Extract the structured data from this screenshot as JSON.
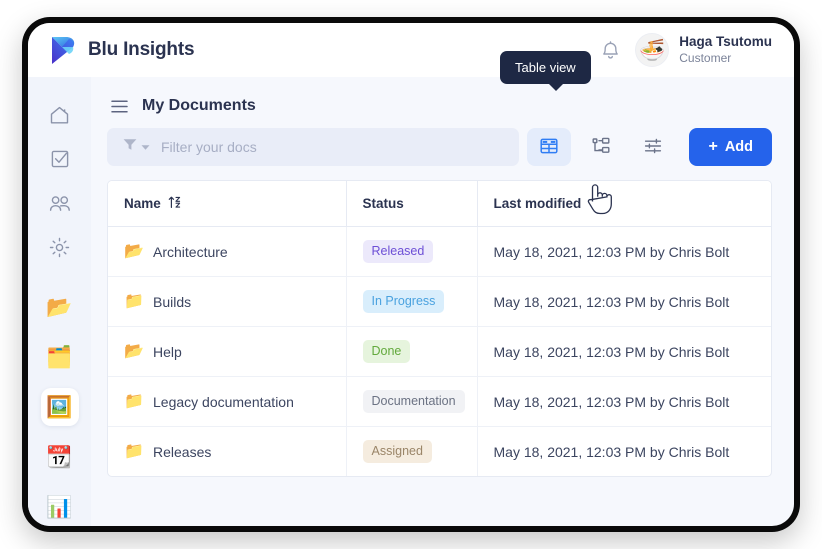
{
  "brand": {
    "name": "Blu Insights",
    "logo_icon": "blu-logo-icon"
  },
  "topbar": {
    "notifications_icon": "bell-icon",
    "user": {
      "name": "Haga Tsutomu",
      "role": "Customer",
      "avatar_icon": "ramen-bowl-avatar"
    }
  },
  "sidebar": {
    "nav": [
      {
        "name": "home",
        "icon": "home-icon"
      },
      {
        "name": "tasks",
        "icon": "checkbox-check-icon"
      },
      {
        "name": "users",
        "icon": "users-icon"
      },
      {
        "name": "settings",
        "icon": "gear-icon"
      }
    ],
    "apps": [
      {
        "name": "documents",
        "icon": "open-file-folder-icon",
        "glyph": "📂",
        "active": false
      },
      {
        "name": "cards",
        "icon": "card-index-dividers-icon",
        "glyph": "🗂️",
        "active": false
      },
      {
        "name": "gallery",
        "icon": "framed-picture-icon",
        "glyph": "🖼️",
        "active": true
      },
      {
        "name": "calendar",
        "icon": "calendar-icon",
        "glyph": "📆",
        "active": false
      },
      {
        "name": "reports",
        "icon": "bar-chart-icon",
        "glyph": "📊",
        "active": false
      }
    ]
  },
  "page": {
    "menu_icon": "hamburger-menu-icon",
    "title": "My Documents"
  },
  "toolbar": {
    "filter_icon": "funnel-filter-icon",
    "filter_caret_icon": "chevron-down-icon",
    "filter_placeholder": "Filter your docs",
    "filter_value": "",
    "table_view_icon": "table-view-icon",
    "tree_view_icon": "tree-view-icon",
    "settings_view_icon": "sliders-settings-icon",
    "add_label": "Add",
    "add_plus": "+",
    "accent_color": "#2563eb"
  },
  "tooltip": {
    "text": "Table view"
  },
  "table": {
    "columns": [
      {
        "key": "name",
        "label": "Name",
        "sort_icon": "sort-az-icon"
      },
      {
        "key": "status",
        "label": "Status"
      },
      {
        "key": "modified",
        "label": "Last modified"
      }
    ],
    "rows": [
      {
        "icon": "open-folder-icon",
        "glyph": "📂",
        "name": "Architecture",
        "status": "Released",
        "status_style": "released",
        "modified": "May 18, 2021, 12:03 PM by Chris Bolt"
      },
      {
        "icon": "closed-folder-icon",
        "glyph": "📁",
        "name": "Builds",
        "status": "In Progress",
        "status_style": "inprogress",
        "modified": "May 18, 2021, 12:03 PM by Chris Bolt"
      },
      {
        "icon": "open-folder-icon",
        "glyph": "📂",
        "name": "Help",
        "status": "Done",
        "status_style": "done",
        "modified": "May 18, 2021, 12:03 PM by Chris Bolt"
      },
      {
        "icon": "closed-folder-icon",
        "glyph": "📁",
        "name": "Legacy documentation",
        "status": "Documentation",
        "status_style": "documentation",
        "modified": "May 18, 2021, 12:03 PM by Chris Bolt"
      },
      {
        "icon": "closed-folder-icon",
        "glyph": "📁",
        "name": "Releases",
        "status": "Assigned",
        "status_style": "assigned",
        "modified": "May 18, 2021, 12:03 PM by Chris Bolt"
      }
    ]
  },
  "cursor": {
    "icon": "pointing-hand-cursor"
  },
  "colors": {
    "badge_released": "#6d4fd6",
    "badge_inprogress": "#4aa2df",
    "badge_done": "#62a93c",
    "badge_documentation": "#6b7283",
    "badge_assigned": "#9a8568",
    "tooltip_bg": "#1e2844",
    "sidebar_bg": "#f1f4fb"
  }
}
